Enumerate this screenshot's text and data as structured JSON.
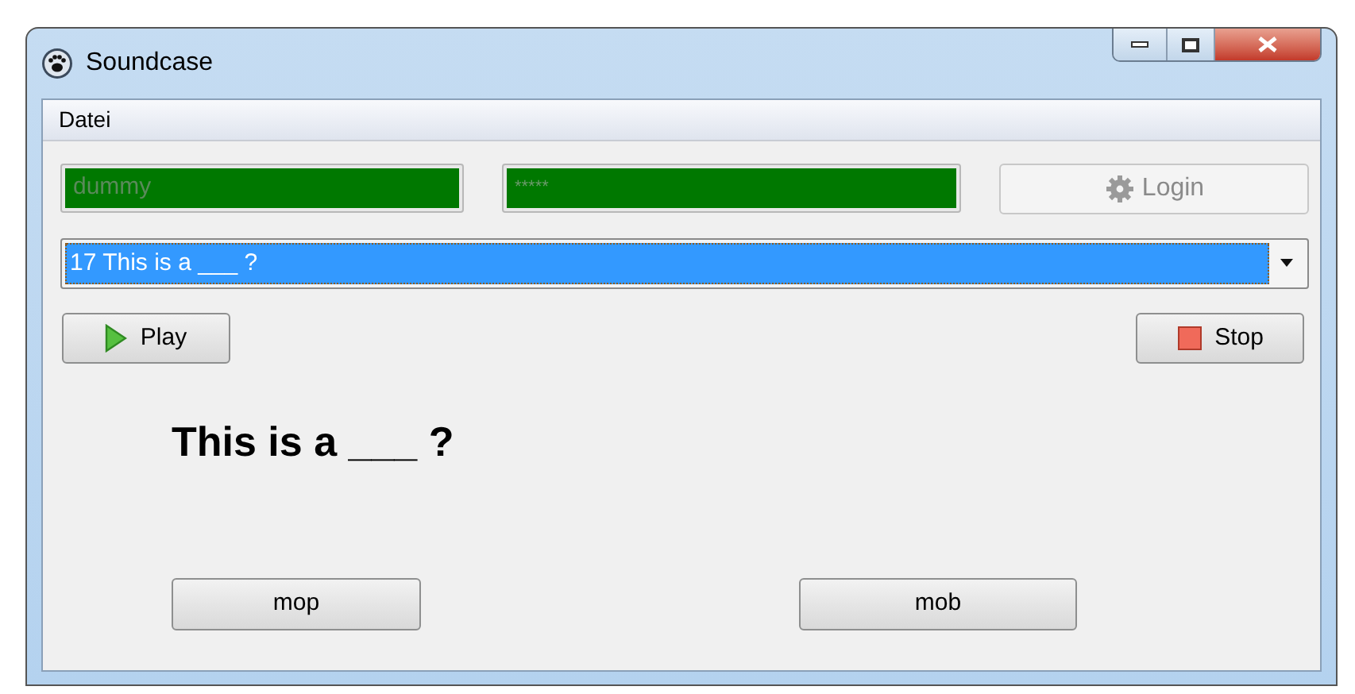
{
  "window": {
    "title": "Soundcase"
  },
  "menu": [
    "Datei"
  ],
  "login": {
    "username": {
      "value": "dummy"
    },
    "password": {
      "value": "*****"
    },
    "button": {
      "label": "Login",
      "disabled": true
    }
  },
  "track_select": {
    "value": "17 This is a ___ ?"
  },
  "play_button": {
    "label": "Play"
  },
  "stop_button": {
    "label": "Stop"
  },
  "question": "This is a ___ ?",
  "answers": [
    {
      "label": "mop"
    },
    {
      "label": "mob"
    }
  ]
}
